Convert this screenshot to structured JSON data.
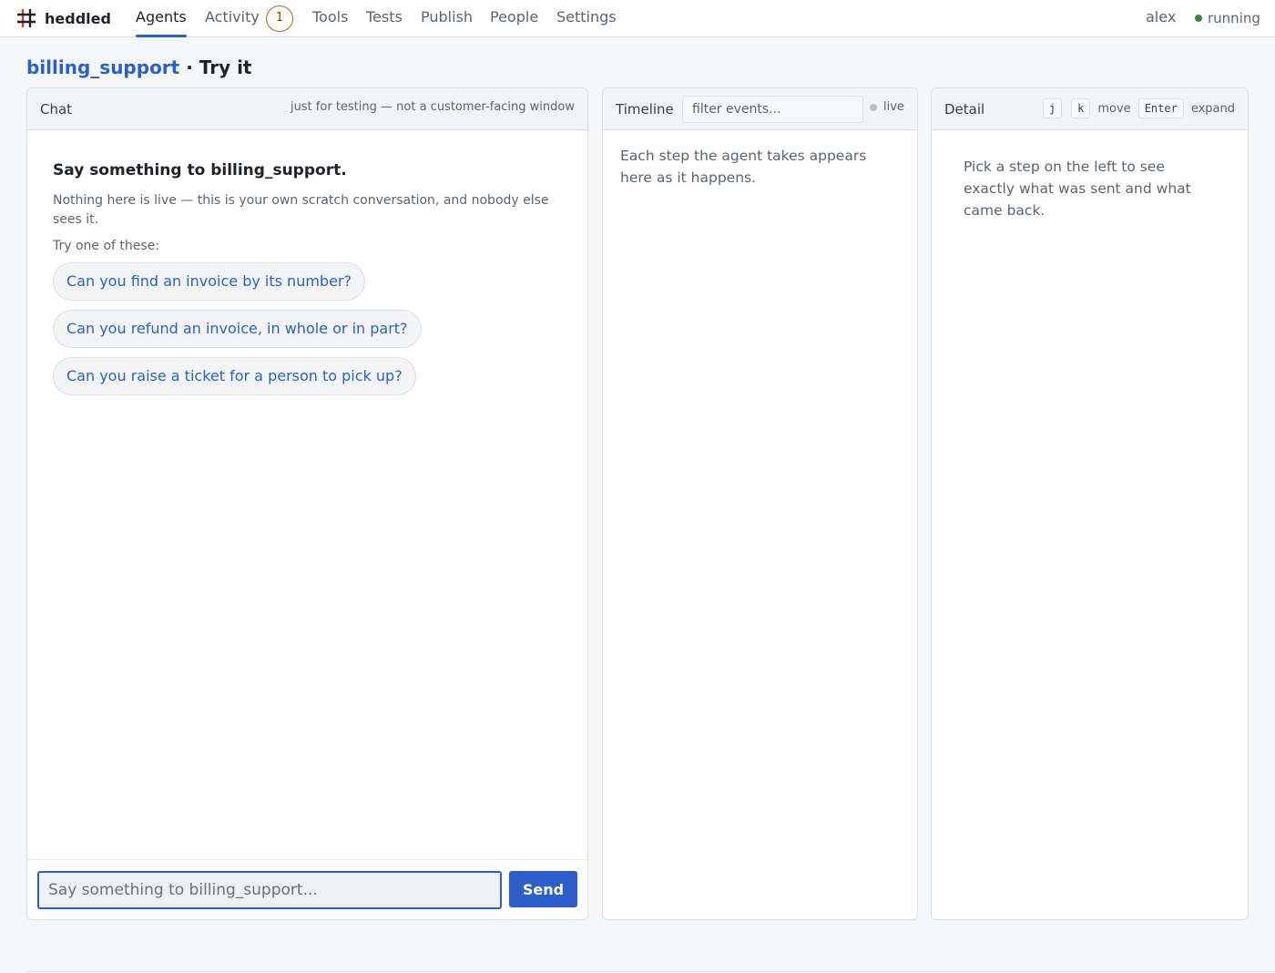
{
  "app": {
    "name": "heddled",
    "icon": "hash-grid-icon",
    "user": "alex",
    "status": "running",
    "status_color": "#2e8b3d"
  },
  "nav": {
    "tabs": [
      {
        "label": "Agents",
        "active": true
      },
      {
        "label": "Activity",
        "badge": "1"
      },
      {
        "label": "Tools"
      },
      {
        "label": "Tests"
      },
      {
        "label": "Publish"
      },
      {
        "label": "People"
      },
      {
        "label": "Settings"
      }
    ]
  },
  "page": {
    "agent": "billing_support",
    "separator": " · ",
    "section": "Try it"
  },
  "chat": {
    "title": "Chat",
    "note": "just for testing — not a customer-facing window",
    "heading": "Say something to billing_support.",
    "intro": "Nothing here is live — this is your own scratch conversation, and nobody else sees it.",
    "try_label": "Try one of these:",
    "suggestions": [
      "Can you find an invoice by its number?",
      "Can you refund an invoice, in whole or in part?",
      "Can you raise a ticket for a person to pick up?"
    ],
    "input_placeholder": "Say something to billing_support...",
    "send_label": "Send"
  },
  "timeline": {
    "title": "Timeline",
    "filter_placeholder": "filter events...",
    "live_label": "live",
    "empty_text": "Each step the agent takes appears here as it happens."
  },
  "detail": {
    "title": "Detail",
    "keys": {
      "down": "j",
      "up": "k",
      "move_label": "move",
      "expand_key": "Enter",
      "expand_label": "expand"
    },
    "empty_text": "Pick a step on the left to see exactly what was sent and what came back."
  },
  "colors": {
    "accent": "#2b5fcb",
    "badge_border": "#a66a1d",
    "live_dot": "#b8c3be"
  }
}
